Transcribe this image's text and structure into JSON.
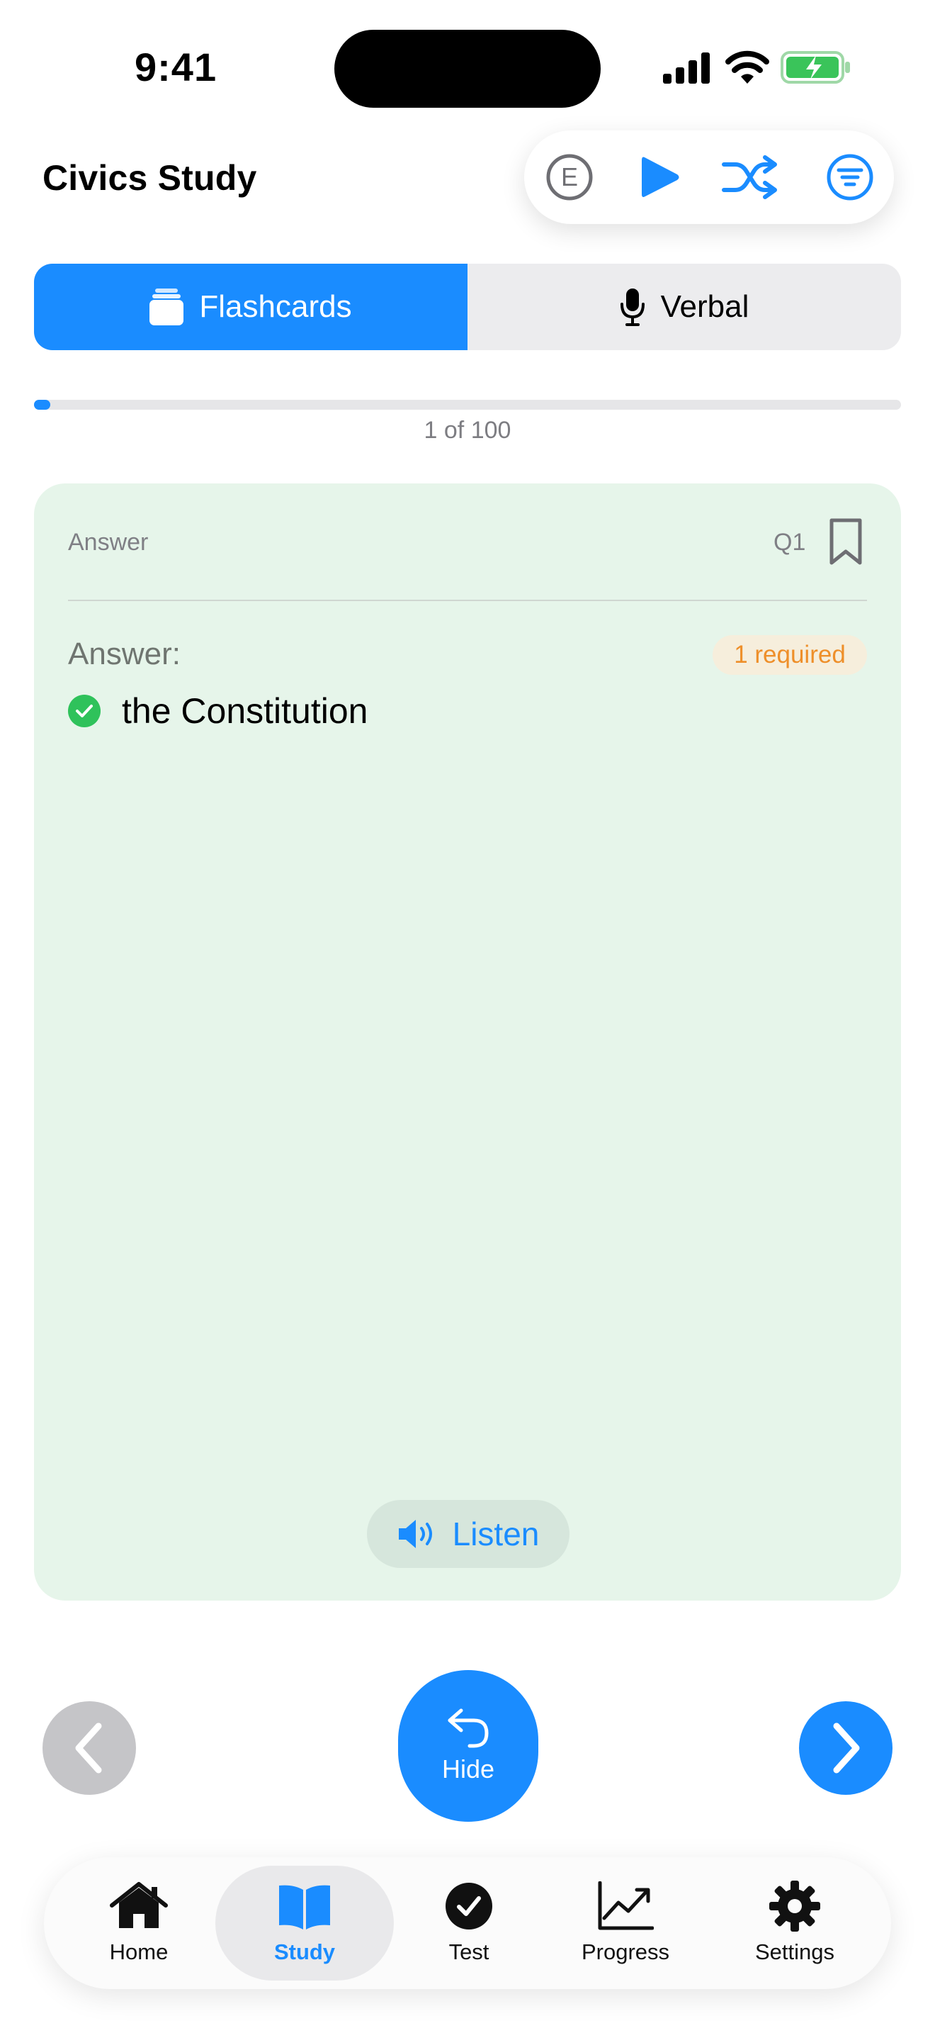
{
  "status_bar": {
    "time": "9:41"
  },
  "header": {
    "title": "Civics Study",
    "toolbar": {
      "language_icon": "E",
      "play_icon": "play-icon",
      "shuffle_icon": "shuffle-icon",
      "filter_icon": "filter-icon"
    }
  },
  "mode_tabs": [
    {
      "label": "Flashcards",
      "icon": "cards-icon",
      "selected": true
    },
    {
      "label": "Verbal",
      "icon": "microphone-icon",
      "selected": false
    }
  ],
  "progress": {
    "current": 1,
    "total": 100,
    "fraction": 0.01,
    "label": "1 of 100"
  },
  "card": {
    "side_label": "Answer",
    "question_number": "Q1",
    "answer_heading": "Answer:",
    "required_badge": "1 required",
    "answers": [
      "the Constitution"
    ],
    "listen_label": "Listen"
  },
  "navigation": {
    "hide_label": "Hide"
  },
  "tab_bar": [
    {
      "label": "Home",
      "icon": "house-icon",
      "selected": false
    },
    {
      "label": "Study",
      "icon": "book-icon",
      "selected": true
    },
    {
      "label": "Test",
      "icon": "checkmark-circle-icon",
      "selected": false
    },
    {
      "label": "Progress",
      "icon": "chart-icon",
      "selected": false
    },
    {
      "label": "Settings",
      "icon": "gear-icon",
      "selected": false
    }
  ],
  "colors": {
    "accent": "#1a8cff",
    "card_bg": "#e6f5ea",
    "success": "#2fc25b",
    "warning": "#ee8f2a"
  }
}
